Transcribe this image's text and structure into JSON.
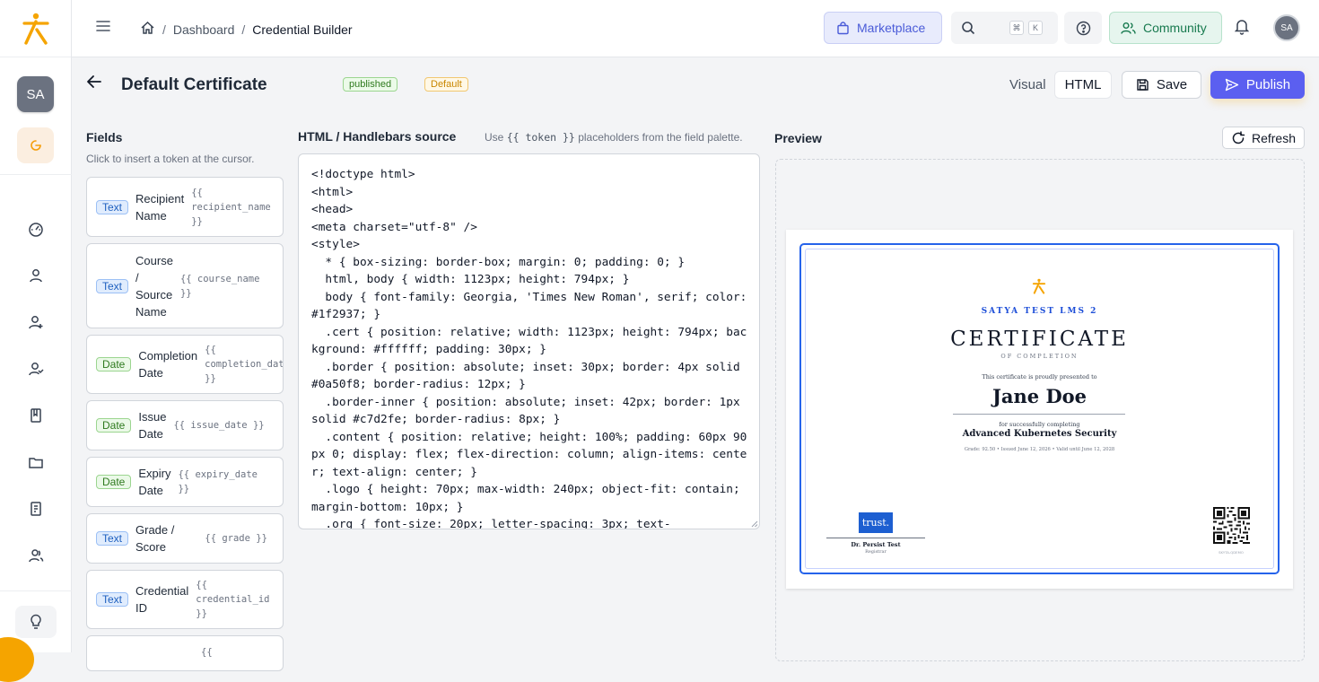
{
  "colors": {
    "brand_orange": "#f5a400",
    "accent": "#5b5ff0",
    "certificate_border": "#2563eb"
  },
  "sidebar": {
    "avatar_initials": "SA",
    "icons": [
      "dashboard-gauge-icon",
      "user-icon",
      "user-plus-icon",
      "users-badge-icon",
      "book-icon",
      "folder-icon",
      "clipboard-list-icon",
      "user-group-icon",
      "lightbulb-icon"
    ]
  },
  "topbar": {
    "breadcrumb": {
      "home_icon": "home-icon",
      "dashboard": "Dashboard",
      "sep": "/",
      "current": "Credential Builder"
    },
    "marketplace": "Marketplace",
    "search_kbd_1": "⌘",
    "search_kbd_2": "K",
    "community": "Community",
    "avatar_initials": "SA"
  },
  "header": {
    "title": "Default Certificate",
    "status_badge": "published",
    "default_badge": "Default",
    "visual_tab": "Visual",
    "html_tab": "HTML",
    "save": "Save",
    "publish": "Publish"
  },
  "fields_panel": {
    "title": "Fields",
    "subtitle": "Click to insert a token at the cursor.",
    "items": [
      {
        "type": "Text",
        "label": "Recipient\nName",
        "token": "{{\nrecipient_name\n}}"
      },
      {
        "type": "Text",
        "label": "Course\n/\nSource\nName",
        "token": "{{ course_name\n}}"
      },
      {
        "type": "Date",
        "label": "Completion\nDate",
        "token": "{{\ncompletion_date\n}}"
      },
      {
        "type": "Date",
        "label": "Issue\nDate",
        "token": "{{ issue_date }}"
      },
      {
        "type": "Date",
        "label": "Expiry\nDate",
        "token": "{{ expiry_date\n}}"
      },
      {
        "type": "Text",
        "label": "Grade /\nScore",
        "token": "{{ grade }}"
      },
      {
        "type": "Text",
        "label": "Credential\nID",
        "token": "{{\ncredential_id\n}}"
      },
      {
        "type": "",
        "label": "",
        "token": "{{"
      }
    ]
  },
  "source_panel": {
    "title": "HTML / Handlebars source",
    "hint_prefix": "Use ",
    "hint_token": "{{ token }}",
    "hint_suffix": " placeholders from the field palette.",
    "code": "<!doctype html>\n<html>\n<head>\n<meta charset=\"utf-8\" />\n<style>\n  * { box-sizing: border-box; margin: 0; padding: 0; }\n  html, body { width: 1123px; height: 794px; }\n  body { font-family: Georgia, 'Times New Roman', serif; color: #1f2937; }\n  .cert { position: relative; width: 1123px; height: 794px; background: #ffffff; padding: 30px; }\n  .border { position: absolute; inset: 30px; border: 4px solid #0a50f8; border-radius: 12px; }\n  .border-inner { position: absolute; inset: 42px; border: 1px solid #c7d2fe; border-radius: 8px; }\n  .content { position: relative; height: 100%; padding: 60px 90px 0; display: flex; flex-direction: column; align-items: center; text-align: center; }\n  .logo { height: 70px; max-width: 240px; object-fit: contain; margin-bottom: 10px; }\n  .org { font-size: 20px; letter-spacing: 3px; text-"
  },
  "preview_panel": {
    "title": "Preview",
    "refresh": "Refresh",
    "certificate": {
      "org": "SATYA TEST LMS 2",
      "title": "CERTIFICATE",
      "subtitle": "OF COMPLETION",
      "presented": "This certificate is proudly presented to",
      "recipient": "Jane Doe",
      "for_text": "for successfully completing",
      "course": "Advanced Kubernetes Security",
      "meta": "Grade: 92.50  •  Issued June 12, 2026  •  Valid until June 12, 2028",
      "sig_logo": "trust.",
      "signer_name": "Dr. Persist Test",
      "signer_role": "Registrar",
      "qr_caption": "SKYTA-QDEMO"
    }
  }
}
